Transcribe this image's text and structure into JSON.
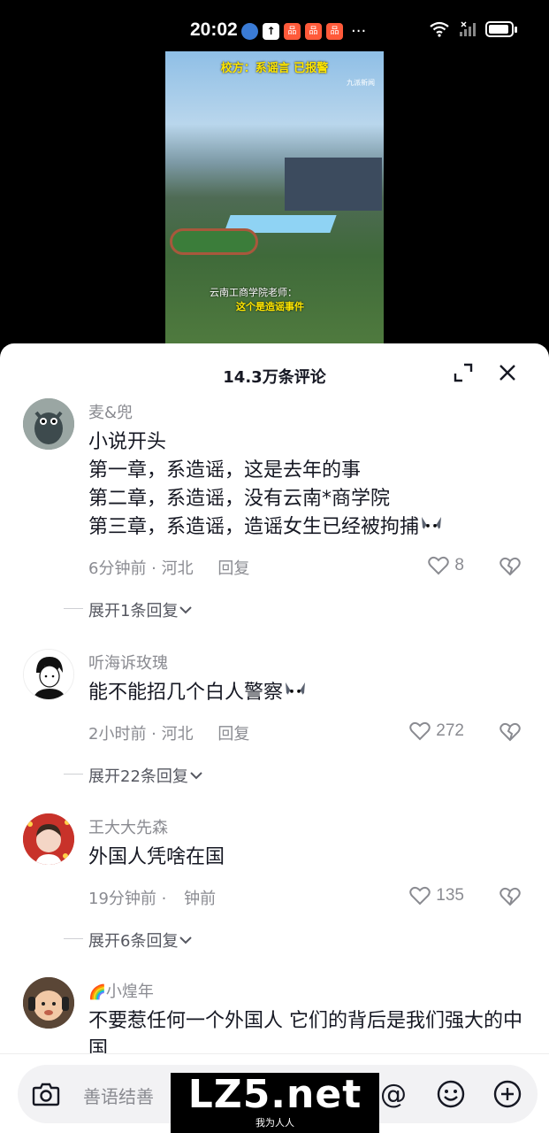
{
  "status_bar": {
    "time": "20:02",
    "icons": [
      "browser-icon",
      "upload-icon",
      "app-icon",
      "app-icon",
      "app-icon"
    ],
    "more": "···"
  },
  "video": {
    "caption_top": "校方：系谣言 已报警",
    "source_tag": "九派新闻",
    "caption_bottom_1": "云南工商学院老师：",
    "caption_bottom_2": "这个是造谣事件"
  },
  "sheet": {
    "title": "14.3万条评论"
  },
  "comments": [
    {
      "name": "麦&兜",
      "text": "小说开头\n第一章，系造谣，这是去年的事\n第二章，系造谣，没有云南*商学院\n第三章，系造谣，造谣女生已经被拘捕",
      "time": "6分钟前 · 河北",
      "reply": "回复",
      "likes": "8",
      "expand": "展开1条回复"
    },
    {
      "name": "听海诉玫瑰",
      "text": "能不能招几个白人警察",
      "time": "2小时前 · 河北",
      "reply": "回复",
      "likes": "272",
      "expand": "展开22条回复"
    },
    {
      "name": "王大大先森",
      "text": "外国人凭啥在国",
      "time": "19分钟前 ·",
      "time_extra": "钟前",
      "reply": "",
      "likes": "135",
      "expand": "展开6条回复"
    },
    {
      "name": "小煌年",
      "text": "不要惹任何一个外国人 它们的背后是我们强大的中国"
    }
  ],
  "input_bar": {
    "placeholder": "善语结善"
  },
  "watermark": {
    "logo": "LZ5.net",
    "sub": "我为人人"
  }
}
